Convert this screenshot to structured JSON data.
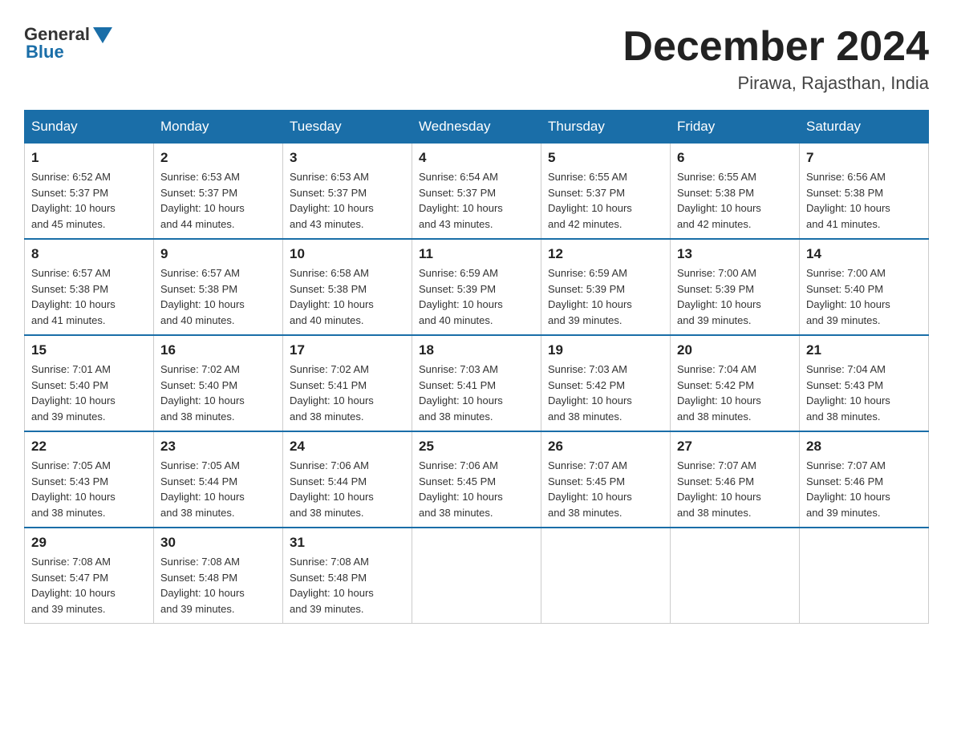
{
  "header": {
    "logo_general": "General",
    "logo_blue": "Blue",
    "month_title": "December 2024",
    "location": "Pirawa, Rajasthan, India"
  },
  "days_of_week": [
    "Sunday",
    "Monday",
    "Tuesday",
    "Wednesday",
    "Thursday",
    "Friday",
    "Saturday"
  ],
  "weeks": [
    [
      {
        "day": "1",
        "sunrise": "6:52 AM",
        "sunset": "5:37 PM",
        "daylight": "10 hours and 45 minutes."
      },
      {
        "day": "2",
        "sunrise": "6:53 AM",
        "sunset": "5:37 PM",
        "daylight": "10 hours and 44 minutes."
      },
      {
        "day": "3",
        "sunrise": "6:53 AM",
        "sunset": "5:37 PM",
        "daylight": "10 hours and 43 minutes."
      },
      {
        "day": "4",
        "sunrise": "6:54 AM",
        "sunset": "5:37 PM",
        "daylight": "10 hours and 43 minutes."
      },
      {
        "day": "5",
        "sunrise": "6:55 AM",
        "sunset": "5:37 PM",
        "daylight": "10 hours and 42 minutes."
      },
      {
        "day": "6",
        "sunrise": "6:55 AM",
        "sunset": "5:38 PM",
        "daylight": "10 hours and 42 minutes."
      },
      {
        "day": "7",
        "sunrise": "6:56 AM",
        "sunset": "5:38 PM",
        "daylight": "10 hours and 41 minutes."
      }
    ],
    [
      {
        "day": "8",
        "sunrise": "6:57 AM",
        "sunset": "5:38 PM",
        "daylight": "10 hours and 41 minutes."
      },
      {
        "day": "9",
        "sunrise": "6:57 AM",
        "sunset": "5:38 PM",
        "daylight": "10 hours and 40 minutes."
      },
      {
        "day": "10",
        "sunrise": "6:58 AM",
        "sunset": "5:38 PM",
        "daylight": "10 hours and 40 minutes."
      },
      {
        "day": "11",
        "sunrise": "6:59 AM",
        "sunset": "5:39 PM",
        "daylight": "10 hours and 40 minutes."
      },
      {
        "day": "12",
        "sunrise": "6:59 AM",
        "sunset": "5:39 PM",
        "daylight": "10 hours and 39 minutes."
      },
      {
        "day": "13",
        "sunrise": "7:00 AM",
        "sunset": "5:39 PM",
        "daylight": "10 hours and 39 minutes."
      },
      {
        "day": "14",
        "sunrise": "7:00 AM",
        "sunset": "5:40 PM",
        "daylight": "10 hours and 39 minutes."
      }
    ],
    [
      {
        "day": "15",
        "sunrise": "7:01 AM",
        "sunset": "5:40 PM",
        "daylight": "10 hours and 39 minutes."
      },
      {
        "day": "16",
        "sunrise": "7:02 AM",
        "sunset": "5:40 PM",
        "daylight": "10 hours and 38 minutes."
      },
      {
        "day": "17",
        "sunrise": "7:02 AM",
        "sunset": "5:41 PM",
        "daylight": "10 hours and 38 minutes."
      },
      {
        "day": "18",
        "sunrise": "7:03 AM",
        "sunset": "5:41 PM",
        "daylight": "10 hours and 38 minutes."
      },
      {
        "day": "19",
        "sunrise": "7:03 AM",
        "sunset": "5:42 PM",
        "daylight": "10 hours and 38 minutes."
      },
      {
        "day": "20",
        "sunrise": "7:04 AM",
        "sunset": "5:42 PM",
        "daylight": "10 hours and 38 minutes."
      },
      {
        "day": "21",
        "sunrise": "7:04 AM",
        "sunset": "5:43 PM",
        "daylight": "10 hours and 38 minutes."
      }
    ],
    [
      {
        "day": "22",
        "sunrise": "7:05 AM",
        "sunset": "5:43 PM",
        "daylight": "10 hours and 38 minutes."
      },
      {
        "day": "23",
        "sunrise": "7:05 AM",
        "sunset": "5:44 PM",
        "daylight": "10 hours and 38 minutes."
      },
      {
        "day": "24",
        "sunrise": "7:06 AM",
        "sunset": "5:44 PM",
        "daylight": "10 hours and 38 minutes."
      },
      {
        "day": "25",
        "sunrise": "7:06 AM",
        "sunset": "5:45 PM",
        "daylight": "10 hours and 38 minutes."
      },
      {
        "day": "26",
        "sunrise": "7:07 AM",
        "sunset": "5:45 PM",
        "daylight": "10 hours and 38 minutes."
      },
      {
        "day": "27",
        "sunrise": "7:07 AM",
        "sunset": "5:46 PM",
        "daylight": "10 hours and 38 minutes."
      },
      {
        "day": "28",
        "sunrise": "7:07 AM",
        "sunset": "5:46 PM",
        "daylight": "10 hours and 39 minutes."
      }
    ],
    [
      {
        "day": "29",
        "sunrise": "7:08 AM",
        "sunset": "5:47 PM",
        "daylight": "10 hours and 39 minutes."
      },
      {
        "day": "30",
        "sunrise": "7:08 AM",
        "sunset": "5:48 PM",
        "daylight": "10 hours and 39 minutes."
      },
      {
        "day": "31",
        "sunrise": "7:08 AM",
        "sunset": "5:48 PM",
        "daylight": "10 hours and 39 minutes."
      },
      null,
      null,
      null,
      null
    ]
  ],
  "labels": {
    "sunrise": "Sunrise:",
    "sunset": "Sunset:",
    "daylight": "Daylight:"
  }
}
